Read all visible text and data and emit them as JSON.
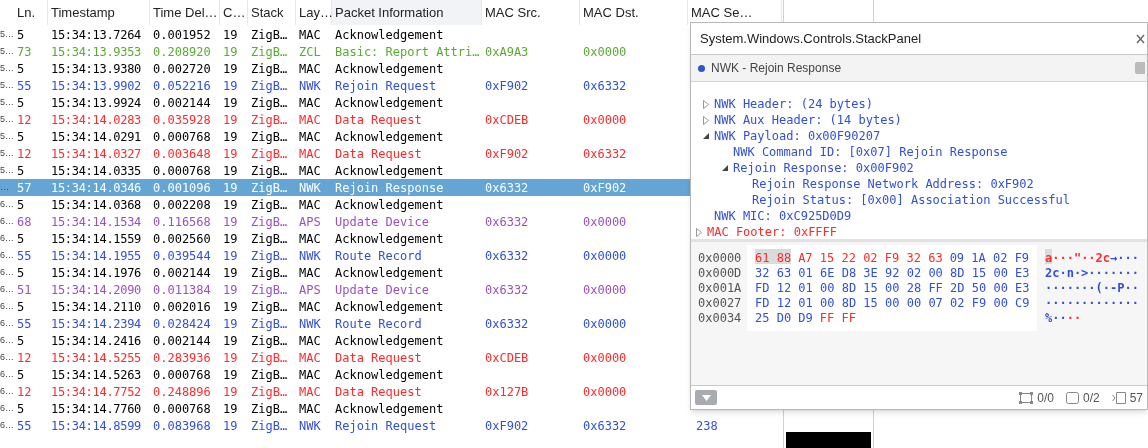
{
  "table": {
    "columns": [
      {
        "label": "Ln.",
        "selected": false
      },
      {
        "label": "Timestamp",
        "selected": false
      },
      {
        "label": "Time Del…",
        "selected": false
      },
      {
        "label": "C…",
        "selected": false
      },
      {
        "label": "Stack",
        "selected": false
      },
      {
        "label": "Lay…",
        "selected": false
      },
      {
        "label": "Packet Information",
        "selected": true
      },
      {
        "label": "MAC Src.",
        "selected": false
      },
      {
        "label": "MAC Dst.",
        "selected": false
      },
      {
        "label": "MAC Se…",
        "selected": false
      }
    ],
    "rows": [
      {
        "column_1": "5…",
        "ln": "5",
        "timestamp": "15:34:13.7264",
        "delta": "0.001952",
        "channel": "19",
        "stack": "ZigB…",
        "layer": "MAC",
        "info": "Acknowledgement",
        "color": "#000000",
        "selected": false
      },
      {
        "column_1": "5…",
        "ln": "73",
        "timestamp": "15:34:13.9353",
        "delta": "0.208920",
        "channel": "19",
        "stack": "ZigB…",
        "layer": "ZCL",
        "info": "Basic: Report Attri…",
        "src": "0xA9A3",
        "dst": "0x0000",
        "color": "#5aaa30",
        "selected": false
      },
      {
        "column_1": "5…",
        "ln": "5",
        "timestamp": "15:34:13.9380",
        "delta": "0.002720",
        "channel": "19",
        "stack": "ZigB…",
        "layer": "MAC",
        "info": "Acknowledgement",
        "color": "#000000",
        "selected": false
      },
      {
        "column_1": "5…",
        "ln": "55",
        "timestamp": "15:34:13.9902",
        "delta": "0.052216",
        "channel": "19",
        "stack": "ZigB…",
        "layer": "NWK",
        "info": "Rejoin Request",
        "src": "0xF902",
        "dst": "0x6332",
        "color": "#3050d8",
        "selected": false
      },
      {
        "column_1": "5…",
        "ln": "5",
        "timestamp": "15:34:13.9924",
        "delta": "0.002144",
        "channel": "19",
        "stack": "ZigB…",
        "layer": "MAC",
        "info": "Acknowledgement",
        "color": "#000000",
        "selected": false
      },
      {
        "column_1": "5…",
        "ln": "12",
        "timestamp": "15:34:14.0283",
        "delta": "0.035928",
        "channel": "19",
        "stack": "ZigB…",
        "layer": "MAC",
        "info": "Data Request",
        "src": "0xCDEB",
        "dst": "0x0000",
        "color": "#ff2a2a",
        "selected": false
      },
      {
        "column_1": "5…",
        "ln": "5",
        "timestamp": "15:34:14.0291",
        "delta": "0.000768",
        "channel": "19",
        "stack": "ZigB…",
        "layer": "MAC",
        "info": "Acknowledgement",
        "color": "#000000",
        "selected": false
      },
      {
        "column_1": "5…",
        "ln": "12",
        "timestamp": "15:34:14.0327",
        "delta": "0.003648",
        "channel": "19",
        "stack": "ZigB…",
        "layer": "MAC",
        "info": "Data Request",
        "src": "0xF902",
        "dst": "0x6332",
        "color": "#ff2a2a",
        "selected": false
      },
      {
        "column_1": "5…",
        "ln": "5",
        "timestamp": "15:34:14.0335",
        "delta": "0.000768",
        "channel": "19",
        "stack": "ZigB…",
        "layer": "MAC",
        "info": "Acknowledgement",
        "color": "#000000",
        "selected": false
      },
      {
        "column_1": "…",
        "ln": "57",
        "timestamp": "15:34:14.0346",
        "delta": "0.001096",
        "channel": "19",
        "stack": "ZigB…",
        "layer": "NWK",
        "info": "Rejoin Response",
        "src": "0x6332",
        "dst": "0xF902",
        "selected": true
      },
      {
        "column_1": "6…",
        "ln": "5",
        "timestamp": "15:34:14.0368",
        "delta": "0.002208",
        "channel": "19",
        "stack": "ZigB…",
        "layer": "MAC",
        "info": "Acknowledgement",
        "color": "#000000",
        "selected": false
      },
      {
        "column_1": "6…",
        "ln": "68",
        "timestamp": "15:34:14.1534",
        "delta": "0.116568",
        "channel": "19",
        "stack": "ZigB…",
        "layer": "APS",
        "info": "Update Device",
        "src": "0x6332",
        "dst": "0x0000",
        "color": "#9a50c0",
        "selected": false
      },
      {
        "column_1": "6…",
        "ln": "5",
        "timestamp": "15:34:14.1559",
        "delta": "0.002560",
        "channel": "19",
        "stack": "ZigB…",
        "layer": "MAC",
        "info": "Acknowledgement",
        "color": "#000000",
        "selected": false
      },
      {
        "column_1": "6…",
        "ln": "55",
        "timestamp": "15:34:14.1955",
        "delta": "0.039544",
        "channel": "19",
        "stack": "ZigB…",
        "layer": "NWK",
        "info": "Route Record",
        "src": "0x6332",
        "dst": "0x0000",
        "color": "#3050d8",
        "selected": false
      },
      {
        "column_1": "6…",
        "ln": "5",
        "timestamp": "15:34:14.1976",
        "delta": "0.002144",
        "channel": "19",
        "stack": "ZigB…",
        "layer": "MAC",
        "info": "Acknowledgement",
        "color": "#000000",
        "selected": false
      },
      {
        "column_1": "6…",
        "ln": "51",
        "timestamp": "15:34:14.2090",
        "delta": "0.011384",
        "channel": "19",
        "stack": "ZigB…",
        "layer": "APS",
        "info": "Update Device",
        "src": "0x6332",
        "dst": "0x0000",
        "color": "#9a50c0",
        "selected": false
      },
      {
        "column_1": "6…",
        "ln": "5",
        "timestamp": "15:34:14.2110",
        "delta": "0.002016",
        "channel": "19",
        "stack": "ZigB…",
        "layer": "MAC",
        "info": "Acknowledgement",
        "color": "#000000",
        "selected": false
      },
      {
        "column_1": "6…",
        "ln": "55",
        "timestamp": "15:34:14.2394",
        "delta": "0.028424",
        "channel": "19",
        "stack": "ZigB…",
        "layer": "NWK",
        "info": "Route Record",
        "src": "0x6332",
        "dst": "0x0000",
        "color": "#3050d8",
        "selected": false
      },
      {
        "column_1": "6…",
        "ln": "5",
        "timestamp": "15:34:14.2416",
        "delta": "0.002144",
        "channel": "19",
        "stack": "ZigB…",
        "layer": "MAC",
        "info": "Acknowledgement",
        "color": "#000000",
        "selected": false
      },
      {
        "column_1": "6…",
        "ln": "12",
        "timestamp": "15:34:14.5255",
        "delta": "0.283936",
        "channel": "19",
        "stack": "ZigB…",
        "layer": "MAC",
        "info": "Data Request",
        "src": "0xCDEB",
        "dst": "0x0000",
        "color": "#ff2a2a",
        "selected": false
      },
      {
        "column_1": "6…",
        "ln": "5",
        "timestamp": "15:34:14.5263",
        "delta": "0.000768",
        "channel": "19",
        "stack": "ZigB…",
        "layer": "MAC",
        "info": "Acknowledgement",
        "color": "#000000",
        "selected": false
      },
      {
        "column_1": "6…",
        "ln": "12",
        "timestamp": "15:34:14.7752",
        "delta": "0.248896",
        "channel": "19",
        "stack": "ZigB…",
        "layer": "MAC",
        "info": "Data Request",
        "src": "0x127B",
        "dst": "0x0000",
        "color": "#ff2a2a",
        "selected": false
      },
      {
        "column_1": "6…",
        "ln": "5",
        "timestamp": "15:34:14.7760",
        "delta": "0.000768",
        "channel": "19",
        "stack": "ZigB…",
        "layer": "MAC",
        "info": "Acknowledgement",
        "color": "#000000",
        "selected": false
      },
      {
        "column_1": "6…",
        "ln": "55",
        "timestamp": "15:34:14.8599",
        "delta": "0.083968",
        "channel": "19",
        "stack": "ZigB…",
        "layer": "NWK",
        "info": "Rejoin Request",
        "src": "0xF902",
        "dst": "0x6332",
        "seq": "238",
        "color": "#3050d8",
        "selected": false
      }
    ]
  },
  "popup": {
    "title": "System.Windows.Controls.StackPanel",
    "header": "NWK - Rejoin Response",
    "tree": [
      {
        "children": [
          {
            "label": "NWK Header: (24 bytes)",
            "expanded": false,
            "color": "#3050d8"
          },
          {
            "label": "NWK Aux Header: (14 bytes)",
            "expanded": false,
            "color": "#3050d8"
          },
          {
            "label": "NWK Payload: 0x00F90207",
            "expanded": true,
            "color": "#3050d8",
            "children": [
              {
                "label": "NWK Command ID: [0x07] Rejoin Response",
                "color": "#3050d8"
              },
              {
                "label": "Rejoin Response: 0x00F902",
                "expanded": true,
                "color": "#3050d8",
                "children": [
                  {
                    "label": "Rejoin Response Network Address: 0xF902",
                    "color": "#3050d8"
                  },
                  {
                    "label": "Rejoin Status: [0x00] Association Successful",
                    "color": "#3050d8"
                  }
                ]
              }
            ]
          },
          {
            "label": "NWK MIC: 0xC925D0D9",
            "color": "#3050d8"
          }
        ]
      },
      {
        "label": "MAC Footer: 0xFFFF",
        "expanded": false,
        "color": "#ff2a2a"
      }
    ],
    "hex": [
      {
        "offset": "0x0000",
        "bytes": [
          {
            "text": "61 88",
            "color": "#ff2a2a",
            "selected": true
          },
          {
            "text": "A7 15 22 02 F9 32 63",
            "color": "#ff2a2a",
            "selected": false
          },
          {
            "text": "09 1A 02 F9",
            "color": "#3050d8",
            "selected": false
          }
        ],
        "ascii": [
          {
            "text": "a",
            "color": "#ff2a2a",
            "selected": true
          },
          {
            "text": "···\"··2c",
            "color": "#ff2a2a",
            "selected": false
          },
          {
            "text": "→···",
            "color": "#3050d8",
            "selected": false
          }
        ]
      },
      {
        "offset": "0x000D",
        "bytes": [
          {
            "text": "32 63 01 6E D8 3E 92 02 00 8D 15 00 E3",
            "color": "#3050d8",
            "selected": false
          }
        ],
        "ascii": [
          {
            "text": "2c·n·>·······",
            "color": "#3050d8",
            "selected": false
          }
        ]
      },
      {
        "offset": "0x001A",
        "bytes": [
          {
            "text": "FD 12 01 00 8D 15 00 28 FF 2D 50 00 E3",
            "color": "#3050d8",
            "selected": false
          }
        ],
        "ascii": [
          {
            "text": "·······(·-P··",
            "color": "#3050d8",
            "selected": false
          }
        ]
      },
      {
        "offset": "0x0027",
        "bytes": [
          {
            "text": "FD 12 01 00 8D 15 00 00 07 02 F9 00 C9",
            "color": "#3050d8",
            "selected": false
          }
        ],
        "ascii": [
          {
            "text": "·············",
            "color": "#3050d8",
            "selected": false
          }
        ]
      },
      {
        "offset": "0x0034",
        "bytes": [
          {
            "text": "25 D0 D9",
            "color": "#3050d8",
            "selected": false
          },
          {
            "text": "FF FF",
            "color": "#ff2a2a",
            "selected": false
          }
        ],
        "ascii": [
          {
            "text": "%··",
            "color": "#3050d8",
            "selected": false
          },
          {
            "text": "··",
            "color": "#ff2a2a",
            "selected": false
          }
        ]
      }
    ],
    "counters": [
      {
        "kind": "selection",
        "text": "0/0"
      },
      {
        "kind": "square",
        "text": "0/2"
      },
      {
        "kind": "frame",
        "text": "57"
      }
    ]
  }
}
